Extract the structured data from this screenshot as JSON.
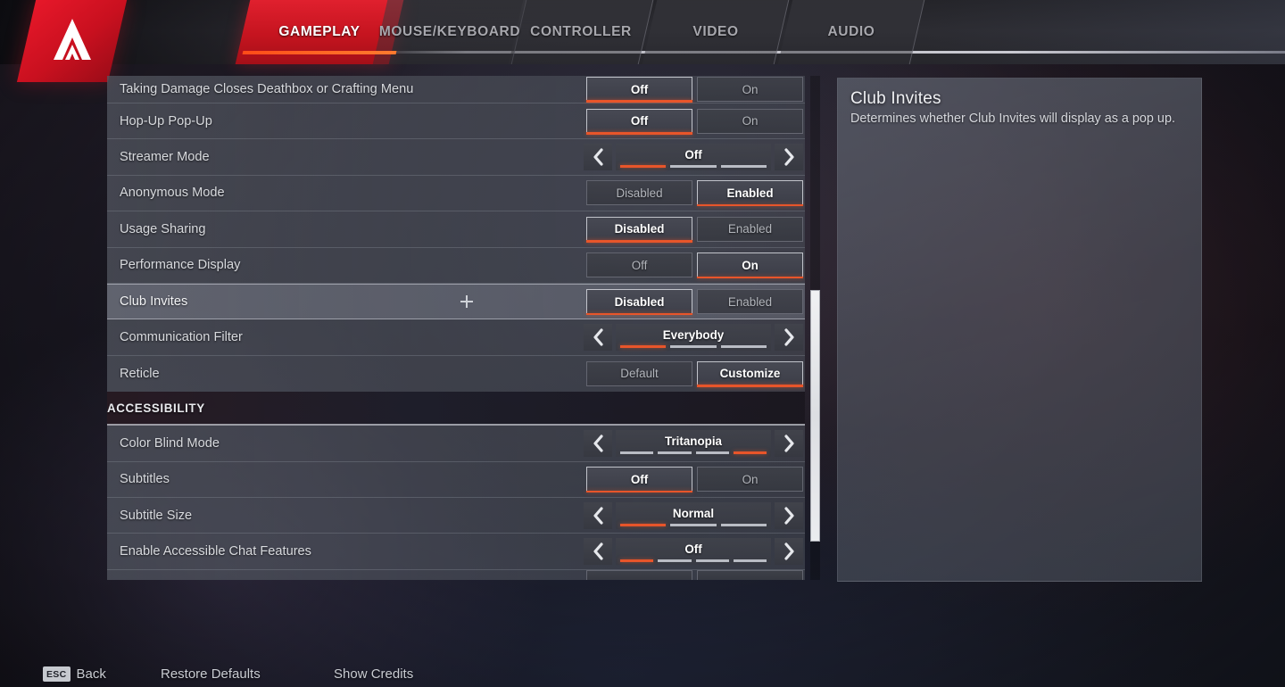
{
  "header": {
    "logo_icon": "apex-legends-logo",
    "tabs": [
      {
        "label": "GAMEPLAY",
        "active": true
      },
      {
        "label": "MOUSE/KEYBOARD",
        "active": false
      },
      {
        "label": "CONTROLLER",
        "active": false
      },
      {
        "label": "VIDEO",
        "active": false
      },
      {
        "label": "AUDIO",
        "active": false
      }
    ]
  },
  "settings": {
    "rows": [
      {
        "label": "Taking Damage Closes Deathbox or Crafting Menu",
        "type": "toggle",
        "options": [
          "Off",
          "On"
        ],
        "selected": 0
      },
      {
        "label": "Hop-Up Pop-Up",
        "type": "toggle",
        "options": [
          "Off",
          "On"
        ],
        "selected": 0
      },
      {
        "label": "Streamer Mode",
        "type": "stepper",
        "value": "Off",
        "segments": 3,
        "active_segment": 0
      },
      {
        "label": "Anonymous Mode",
        "type": "toggle",
        "options": [
          "Disabled",
          "Enabled"
        ],
        "selected": 1
      },
      {
        "label": "Usage Sharing",
        "type": "toggle",
        "options": [
          "Disabled",
          "Enabled"
        ],
        "selected": 0
      },
      {
        "label": "Performance Display",
        "type": "toggle",
        "options": [
          "Off",
          "On"
        ],
        "selected": 1
      },
      {
        "label": "Club Invites",
        "type": "toggle",
        "options": [
          "Disabled",
          "Enabled"
        ],
        "selected": 0,
        "hovered": true
      },
      {
        "label": "Communication Filter",
        "type": "stepper",
        "value": "Everybody",
        "segments": 3,
        "active_segment": 0
      },
      {
        "label": "Reticle",
        "type": "toggle",
        "options": [
          "Default",
          "Customize"
        ],
        "selected": 1
      }
    ],
    "section_header": "ACCESSIBILITY",
    "accessibility_rows": [
      {
        "label": "Color Blind Mode",
        "type": "stepper",
        "value": "Tritanopia",
        "segments": 4,
        "active_segment": 3
      },
      {
        "label": "Subtitles",
        "type": "toggle",
        "options": [
          "Off",
          "On"
        ],
        "selected": 0
      },
      {
        "label": "Subtitle Size",
        "type": "stepper",
        "value": "Normal",
        "segments": 3,
        "active_segment": 0
      },
      {
        "label": "Enable Accessible Chat Features",
        "type": "stepper",
        "value": "Off",
        "segments": 4,
        "active_segment": 0
      }
    ]
  },
  "detail": {
    "title": "Club Invites",
    "description": "Determines whether Club Invites will display as a pop up."
  },
  "footer": {
    "back_key": "ESC",
    "back_label": "Back",
    "restore_defaults": "Restore Defaults",
    "show_credits": "Show Credits"
  },
  "colors": {
    "accent_orange": "#e8552a",
    "brand_red": "#c5141f",
    "row_bg": "#545862",
    "text_primary": "#ffffff",
    "text_secondary": "#b2b5bb"
  }
}
